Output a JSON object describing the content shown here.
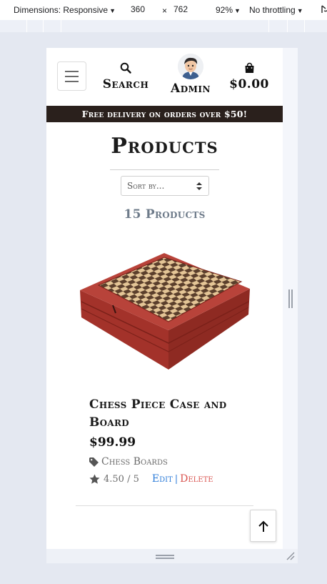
{
  "devtools": {
    "dimensions_label": "Dimensions: Responsive",
    "width": "360",
    "height": "762",
    "times": "×",
    "zoom": "92%",
    "throttling": "No throttling"
  },
  "header": {
    "search_label": "Search",
    "admin_label": "Admin",
    "cart_total": "$0.00"
  },
  "banner": "Free delivery on orders over $50!",
  "page": {
    "title": "Products",
    "sort_placeholder": "Sort by...",
    "count": "15 Products"
  },
  "product": {
    "name": "Chess Piece Case and Board",
    "price": "$99.99",
    "category": "Chess Boards",
    "rating": "4.50 / 5",
    "edit_label": "Edit",
    "separator": "|",
    "delete_label": "Delete"
  },
  "colors": {
    "banner_bg": "#2a201c",
    "edit_link": "#2b7bd8",
    "delete_link": "#d9534f",
    "muted_text": "#6e7b8a"
  },
  "icons": [
    "hamburger-icon",
    "search-icon",
    "avatar",
    "shopping-bag-icon",
    "tag-icon",
    "star-icon",
    "arrow-up-icon"
  ]
}
